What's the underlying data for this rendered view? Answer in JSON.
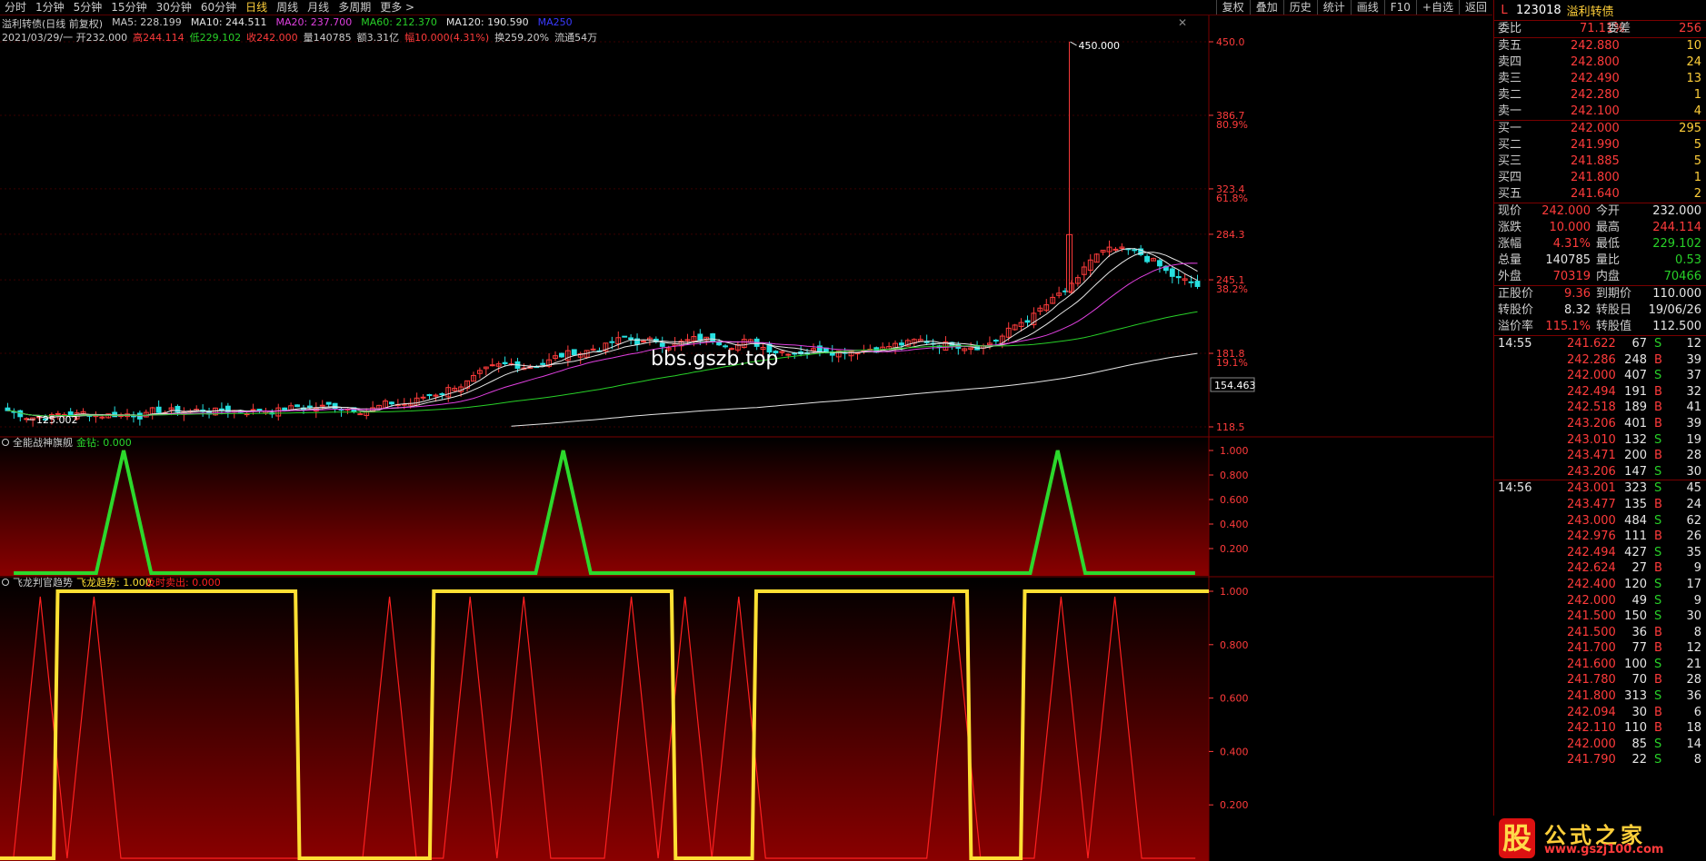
{
  "toolbar": {
    "periods": [
      "分时",
      "1分钟",
      "5分钟",
      "15分钟",
      "30分钟",
      "60分钟",
      "日线",
      "周线",
      "月线",
      "多周期",
      "更多 >"
    ],
    "active_period": "日线",
    "right_buttons": [
      "复权",
      "叠加",
      "历史",
      "统计",
      "画线",
      "F10",
      "+自选",
      "返回"
    ]
  },
  "title_line": {
    "name": "溢利转债(日线 前复权)",
    "ma5": "MA5: 228.199",
    "ma10": "MA10: 244.511",
    "ma20": "MA20: 237.700",
    "ma60": "MA60: 212.370",
    "ma120": "MA120: 190.590",
    "ma250": "MA250"
  },
  "quote_line": {
    "date_open": "2021/03/29/一 开232.000",
    "high": "高244.114",
    "low": "低229.102",
    "close": "收242.000",
    "volume": "量140785",
    "amount": "额3.31亿",
    "change": "幅10.000(4.31%)",
    "turnover": "换259.20%",
    "float": "流通54万"
  },
  "main_axis": {
    "ticks": [
      "450.0",
      "386.7",
      "323.4",
      "284.3",
      "245.1",
      "181.8",
      "118.5"
    ],
    "pct_ticks": [
      "80.9%",
      "61.8%",
      "38.2%",
      "19.1%"
    ],
    "current_price_label": "154.463",
    "high_marker": "450.000",
    "low_marker": "125.002"
  },
  "watermark": "bbs.gszb.top",
  "indicator1": {
    "name": "全能战神旗舰",
    "param": "金钻: 0.000",
    "ticks": [
      "1.000",
      "0.800",
      "0.600",
      "0.400",
      "0.200"
    ]
  },
  "indicator2": {
    "name": "飞龙判官趋势",
    "param1": "飞龙趋势: 1.000",
    "param2": "及时卖出: 0.000",
    "ticks": [
      "1.000",
      "0.800",
      "0.600",
      "0.400",
      "0.200"
    ]
  },
  "chart_data": [
    {
      "type": "line",
      "title": "全能战神旗舰",
      "series": [
        {
          "name": "金钻",
          "values": [
            0,
            0,
            0,
            0,
            1,
            0,
            0,
            0,
            0,
            0,
            0,
            0,
            0,
            0,
            0,
            0,
            0,
            0,
            0,
            0,
            1,
            0,
            0,
            0,
            0,
            0,
            0,
            0,
            0,
            0,
            0,
            0,
            0,
            0,
            0,
            0,
            0,
            0,
            1,
            0,
            0,
            0,
            0,
            0
          ]
        }
      ],
      "ylim": [
        0,
        1
      ]
    },
    {
      "type": "line",
      "title": "飞龙判官趋势",
      "series": [
        {
          "name": "飞龙趋势",
          "values": [
            0,
            0,
            1,
            1,
            1,
            1,
            1,
            1,
            1,
            1,
            1,
            0,
            0,
            0,
            0,
            0,
            1,
            1,
            1,
            1,
            1,
            1,
            1,
            1,
            1,
            0,
            0,
            0,
            1,
            1,
            1,
            1,
            1,
            1,
            1,
            1,
            0,
            0,
            1,
            1,
            1,
            1,
            1,
            1,
            1
          ]
        },
        {
          "name": "及时卖出",
          "values": [
            0,
            1,
            0,
            1,
            0,
            0,
            0,
            0,
            0,
            0,
            0,
            0,
            0,
            0,
            1,
            0,
            0,
            1,
            0,
            1,
            0,
            0,
            0,
            1,
            0,
            1,
            0,
            1,
            0,
            0,
            0,
            0,
            0,
            0,
            0,
            1,
            0,
            0,
            0,
            1,
            0,
            1,
            0,
            0,
            0
          ]
        }
      ],
      "ylim": [
        0,
        1
      ]
    }
  ],
  "right_panel": {
    "header": {
      "mark": "L",
      "code": "123018",
      "name": "溢利转债"
    },
    "weibi": {
      "label": "委比",
      "value": "71.11%",
      "label2": "委差",
      "value2": "256"
    },
    "sells": [
      {
        "label": "卖五",
        "price": "242.880",
        "vol": "10"
      },
      {
        "label": "卖四",
        "price": "242.800",
        "vol": "24"
      },
      {
        "label": "卖三",
        "price": "242.490",
        "vol": "13"
      },
      {
        "label": "卖二",
        "price": "242.280",
        "vol": "1"
      },
      {
        "label": "卖一",
        "price": "242.100",
        "vol": "4"
      }
    ],
    "buys": [
      {
        "label": "买一",
        "price": "242.000",
        "vol": "295"
      },
      {
        "label": "买二",
        "price": "241.990",
        "vol": "5"
      },
      {
        "label": "买三",
        "price": "241.885",
        "vol": "5"
      },
      {
        "label": "买四",
        "price": "241.800",
        "vol": "1"
      },
      {
        "label": "买五",
        "price": "241.640",
        "vol": "2"
      }
    ],
    "stats": [
      {
        "l1": "现价",
        "v1": "242.000",
        "c1": "red",
        "l2": "今开",
        "v2": "232.000",
        "c2": "wht"
      },
      {
        "l1": "涨跌",
        "v1": "10.000",
        "c1": "red",
        "l2": "最高",
        "v2": "244.114",
        "c2": "red"
      },
      {
        "l1": "涨幅",
        "v1": "4.31%",
        "c1": "red",
        "l2": "最低",
        "v2": "229.102",
        "c2": "grn"
      },
      {
        "l1": "总量",
        "v1": "140785",
        "c1": "wht",
        "l2": "量比",
        "v2": "0.53",
        "c2": "grn"
      },
      {
        "l1": "外盘",
        "v1": "70319",
        "c1": "red",
        "l2": "内盘",
        "v2": "70466",
        "c2": "grn"
      }
    ],
    "bond": [
      {
        "l1": "正股价",
        "v1": "9.36",
        "c1": "red",
        "l2": "到期价",
        "v2": "110.000",
        "c2": "wht"
      },
      {
        "l1": "转股价",
        "v1": "8.32",
        "c1": "wht",
        "l2": "转股日",
        "v2": "19/06/26",
        "c2": "wht"
      },
      {
        "l1": "溢价率",
        "v1": "115.1%",
        "c1": "red",
        "l2": "转股值",
        "v2": "112.500",
        "c2": "wht"
      }
    ],
    "ticks_block1": {
      "time": "14:55",
      "rows": [
        {
          "price": "241.622",
          "vol": "67",
          "bs": "S",
          "n": "12"
        },
        {
          "price": "242.286",
          "vol": "248",
          "bs": "B",
          "n": "39"
        },
        {
          "price": "242.000",
          "vol": "407",
          "bs": "S",
          "n": "37"
        },
        {
          "price": "242.494",
          "vol": "191",
          "bs": "B",
          "n": "32"
        },
        {
          "price": "242.518",
          "vol": "189",
          "bs": "B",
          "n": "41"
        },
        {
          "price": "243.206",
          "vol": "401",
          "bs": "B",
          "n": "39"
        },
        {
          "price": "243.010",
          "vol": "132",
          "bs": "S",
          "n": "19"
        },
        {
          "price": "243.471",
          "vol": "200",
          "bs": "B",
          "n": "28"
        },
        {
          "price": "243.206",
          "vol": "147",
          "bs": "S",
          "n": "30"
        }
      ]
    },
    "ticks_block2": {
      "time": "14:56",
      "rows": [
        {
          "price": "243.001",
          "vol": "323",
          "bs": "S",
          "n": "45"
        },
        {
          "price": "243.477",
          "vol": "135",
          "bs": "B",
          "n": "24"
        },
        {
          "price": "243.000",
          "vol": "484",
          "bs": "S",
          "n": "62"
        },
        {
          "price": "242.976",
          "vol": "111",
          "bs": "B",
          "n": "26"
        },
        {
          "price": "242.494",
          "vol": "427",
          "bs": "S",
          "n": "35"
        },
        {
          "price": "242.624",
          "vol": "27",
          "bs": "B",
          "n": "9"
        },
        {
          "price": "242.400",
          "vol": "120",
          "bs": "S",
          "n": "17"
        },
        {
          "price": "242.000",
          "vol": "49",
          "bs": "S",
          "n": "9"
        },
        {
          "price": "241.500",
          "vol": "150",
          "bs": "S",
          "n": "30"
        },
        {
          "price": "241.500",
          "vol": "36",
          "bs": "B",
          "n": "8"
        },
        {
          "price": "241.700",
          "vol": "77",
          "bs": "B",
          "n": "12"
        },
        {
          "price": "241.600",
          "vol": "100",
          "bs": "S",
          "n": "21"
        },
        {
          "price": "241.780",
          "vol": "70",
          "bs": "B",
          "n": "28"
        },
        {
          "price": "241.800",
          "vol": "313",
          "bs": "S",
          "n": "36"
        },
        {
          "price": "242.094",
          "vol": "30",
          "bs": "B",
          "n": "6"
        },
        {
          "price": "242.110",
          "vol": "110",
          "bs": "B",
          "n": "18"
        },
        {
          "price": "242.000",
          "vol": "85",
          "bs": "S",
          "n": "14"
        },
        {
          "price": "241.790",
          "vol": "22",
          "bs": "S",
          "n": "8"
        }
      ]
    }
  },
  "brand": {
    "glyph": "股",
    "title": "公式之家",
    "url": "www.gszj100.com"
  }
}
